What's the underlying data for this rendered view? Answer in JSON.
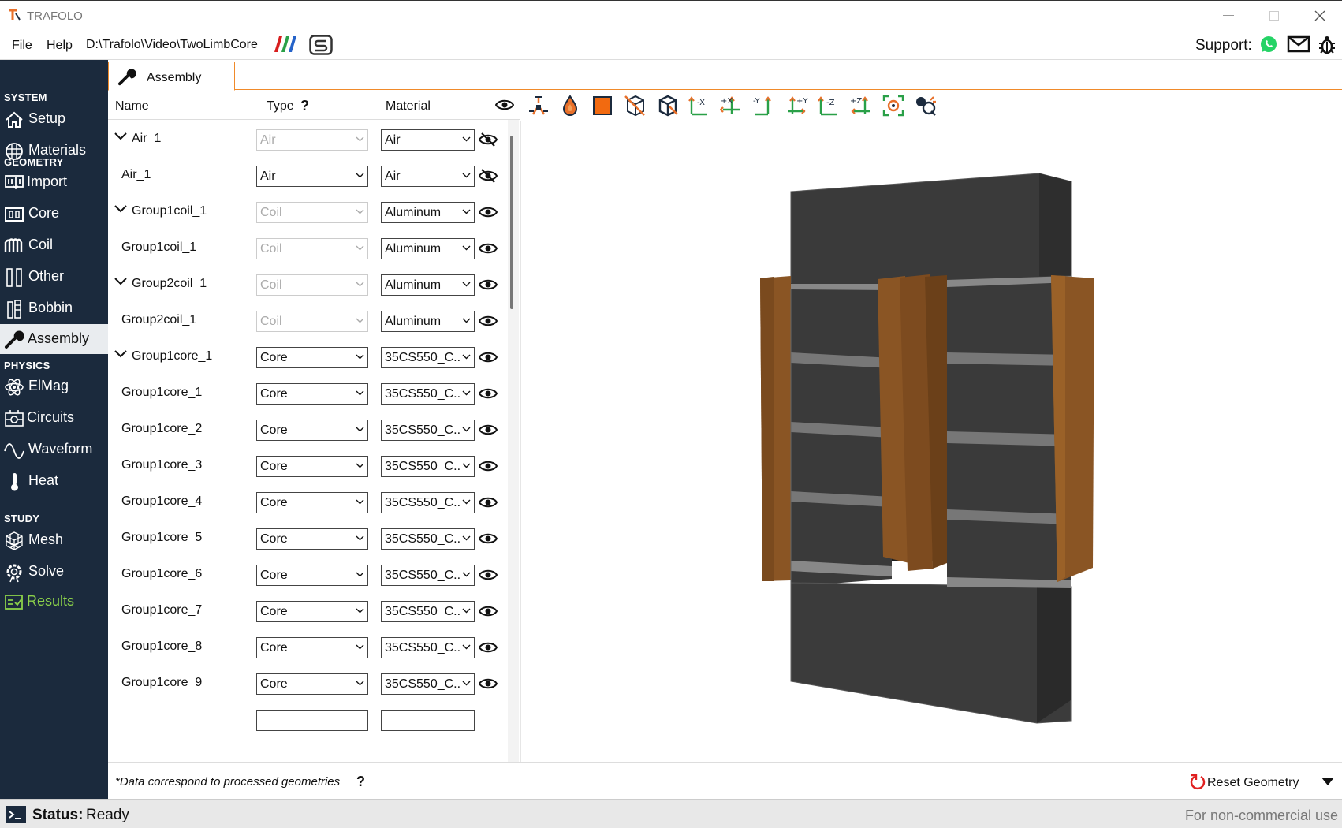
{
  "window": {
    "title": "TRAFOLO"
  },
  "menu": {
    "file": "File",
    "help": "Help",
    "path": "D:\\Trafolo\\Video\\TwoLimbCore",
    "support": "Support:"
  },
  "sidebar": {
    "system": "SYSTEM",
    "geometry": "GEOMETRY",
    "physics": "PHYSICS",
    "study": "STUDY",
    "items": {
      "setup": "Setup",
      "materials": "Materials",
      "import": "Import",
      "core": "Core",
      "coil": "Coil",
      "other": "Other",
      "bobbin": "Bobbin",
      "assembly": "Assembly",
      "elmag": "ElMag",
      "circuits": "Circuits",
      "waveform": "Waveform",
      "heat": "Heat",
      "mesh": "Mesh",
      "solve": "Solve",
      "results": "Results"
    }
  },
  "tab": {
    "label": "Assembly"
  },
  "list": {
    "headers": {
      "name": "Name",
      "type": "Type",
      "type_help": "?",
      "material": "Material"
    },
    "rows": [
      {
        "name": "Air_1",
        "type": "Air",
        "material": "Air",
        "group": true,
        "type_disabled": true,
        "hidden": true
      },
      {
        "name": "Air_1",
        "type": "Air",
        "material": "Air",
        "group": false,
        "type_disabled": false,
        "hidden": true
      },
      {
        "name": "Group1coil_1",
        "type": "Coil",
        "material": "Aluminum",
        "group": true,
        "type_disabled": true,
        "hidden": false
      },
      {
        "name": "Group1coil_1",
        "type": "Coil",
        "material": "Aluminum",
        "group": false,
        "type_disabled": true,
        "hidden": false
      },
      {
        "name": "Group2coil_1",
        "type": "Coil",
        "material": "Aluminum",
        "group": true,
        "type_disabled": true,
        "hidden": false
      },
      {
        "name": "Group2coil_1",
        "type": "Coil",
        "material": "Aluminum",
        "group": false,
        "type_disabled": true,
        "hidden": false
      },
      {
        "name": "Group1core_1",
        "type": "Core",
        "material": "35CS550_C...",
        "group": true,
        "type_disabled": false,
        "hidden": false
      },
      {
        "name": "Group1core_1",
        "type": "Core",
        "material": "35CS550_C...",
        "group": false,
        "type_disabled": false,
        "hidden": false
      },
      {
        "name": "Group1core_2",
        "type": "Core",
        "material": "35CS550_C...",
        "group": false,
        "type_disabled": false,
        "hidden": false
      },
      {
        "name": "Group1core_3",
        "type": "Core",
        "material": "35CS550_C...",
        "group": false,
        "type_disabled": false,
        "hidden": false
      },
      {
        "name": "Group1core_4",
        "type": "Core",
        "material": "35CS550_C...",
        "group": false,
        "type_disabled": false,
        "hidden": false
      },
      {
        "name": "Group1core_5",
        "type": "Core",
        "material": "35CS550_C...",
        "group": false,
        "type_disabled": false,
        "hidden": false
      },
      {
        "name": "Group1core_6",
        "type": "Core",
        "material": "35CS550_C...",
        "group": false,
        "type_disabled": false,
        "hidden": false
      },
      {
        "name": "Group1core_7",
        "type": "Core",
        "material": "35CS550_C...",
        "group": false,
        "type_disabled": false,
        "hidden": false
      },
      {
        "name": "Group1core_8",
        "type": "Core",
        "material": "35CS550_C...",
        "group": false,
        "type_disabled": false,
        "hidden": false
      },
      {
        "name": "Group1core_9",
        "type": "Core",
        "material": "35CS550_C...",
        "group": false,
        "type_disabled": false,
        "hidden": false
      }
    ]
  },
  "toolbar": {
    "labels": {
      "mx": "-X",
      "px": "+X",
      "my": "-Y",
      "py": "+Y",
      "mz": "-Z",
      "pz": "+Z"
    }
  },
  "footer": {
    "note": "*Data correspond to processed geometries",
    "note_help": "?",
    "reset": "Reset Geometry"
  },
  "status": {
    "label": "Status:",
    "value": "Ready",
    "license": "For non-commercial use"
  },
  "colors": {
    "sidebar": "#1b2a3d",
    "accent": "#f08a2a",
    "results": "#8bd14a",
    "core": "#3a3a3a",
    "coil": "#8a5524"
  }
}
